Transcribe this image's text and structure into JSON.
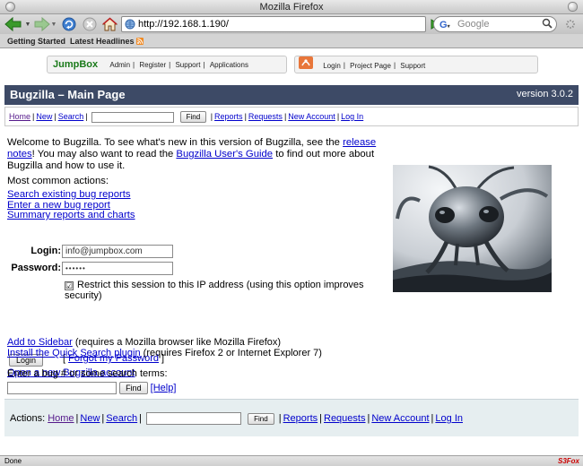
{
  "window": {
    "title": "Mozilla Firefox"
  },
  "toolbar": {
    "url": "http://192.168.1.190/",
    "search_placeholder": "Google"
  },
  "bookmarks": {
    "items": [
      "Getting Started",
      "Latest Headlines"
    ]
  },
  "jumpbox_bar": {
    "logo": "JumpBox",
    "left_links": [
      "Admin",
      "Register",
      "Support",
      "Applications"
    ],
    "right_links": [
      "Login",
      "Project Page",
      "Support"
    ]
  },
  "header": {
    "title": "Bugzilla – Main Page",
    "version": "version 3.0.2"
  },
  "nav_links": {
    "home": "Home",
    "new": "New",
    "search": "Search",
    "find": "Find",
    "reports": "Reports",
    "requests": "Requests",
    "new_account": "New Account",
    "log_in": "Log In"
  },
  "intro": {
    "p1_a": "Welcome to Bugzilla. To see what's new in this version of Bugzilla, see the ",
    "release_notes": "release notes",
    "p1_b": "! You may also want to read the ",
    "users_guide": "Bugzilla User's Guide",
    "p1_c": " to find out more about Bugzilla and how to use it."
  },
  "common_actions": {
    "title": "Most common actions:",
    "links": [
      "Search existing bug reports",
      "Enter a new bug report",
      "Summary reports and charts"
    ]
  },
  "login": {
    "login_label": "Login:",
    "login_value": "info@jumpbox.com",
    "password_label": "Password:",
    "password_value": "••••••",
    "restrict_check": "☑",
    "restrict_text": "Restrict this session to this IP address (using this option improves security)",
    "login_button": "Login",
    "forgot_open": "[ ",
    "forgot_link": "Forgot my Password",
    "forgot_close": " ]",
    "open_account": "Open a new Bugzilla account"
  },
  "extras": {
    "sidebar_link": "Add to Sidebar",
    "sidebar_text": " (requires a Mozilla browser like Mozilla Firefox)",
    "quicksearch_link": "Install the Quick Search plugin",
    "quicksearch_text": " (requires Firefox 2 or Internet Explorer 7)"
  },
  "quick_search": {
    "label": "Enter a bug # or some search terms:",
    "find_button": "Find",
    "help_link": "[Help]"
  },
  "footer": {
    "actions_label": "Actions:"
  },
  "status": {
    "text": "Done",
    "s3fox": "S3Fox"
  }
}
